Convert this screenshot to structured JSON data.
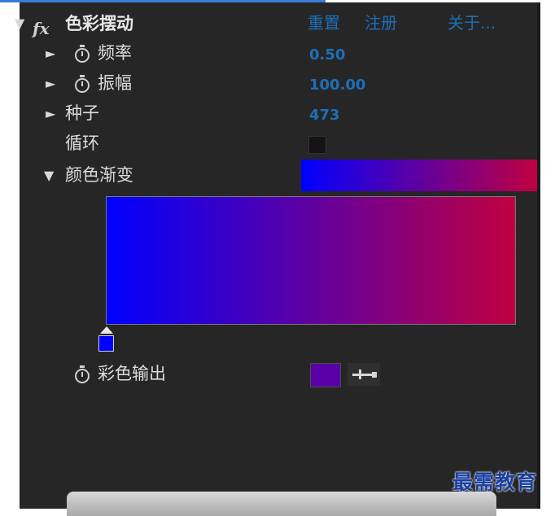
{
  "effect": {
    "name": "色彩摆动",
    "fx_label": "fx",
    "links": {
      "reset": "重置",
      "register": "注册",
      "about": "关于..."
    }
  },
  "properties": {
    "frequency": {
      "label": "频率",
      "value": "0.50"
    },
    "amplitude": {
      "label": "振幅",
      "value": "100.00"
    },
    "seed": {
      "label": "种子",
      "value": "473"
    },
    "loop": {
      "label": "循环",
      "checked": false
    },
    "gradient": {
      "label": "颜色渐变",
      "start_color": "#0000ff",
      "end_color": "#c00040"
    },
    "color_output": {
      "label": "彩色输出",
      "color": "#5a00a8"
    }
  },
  "icons": {
    "twirl_collapsed": "triangle-right-icon",
    "twirl_expanded": "triangle-down-icon",
    "stopwatch": "stopwatch-icon",
    "eyedropper": "eyedropper-icon"
  },
  "glyphs": {
    "collapsed": "►",
    "expanded": "▼"
  },
  "watermark": "最需教育"
}
